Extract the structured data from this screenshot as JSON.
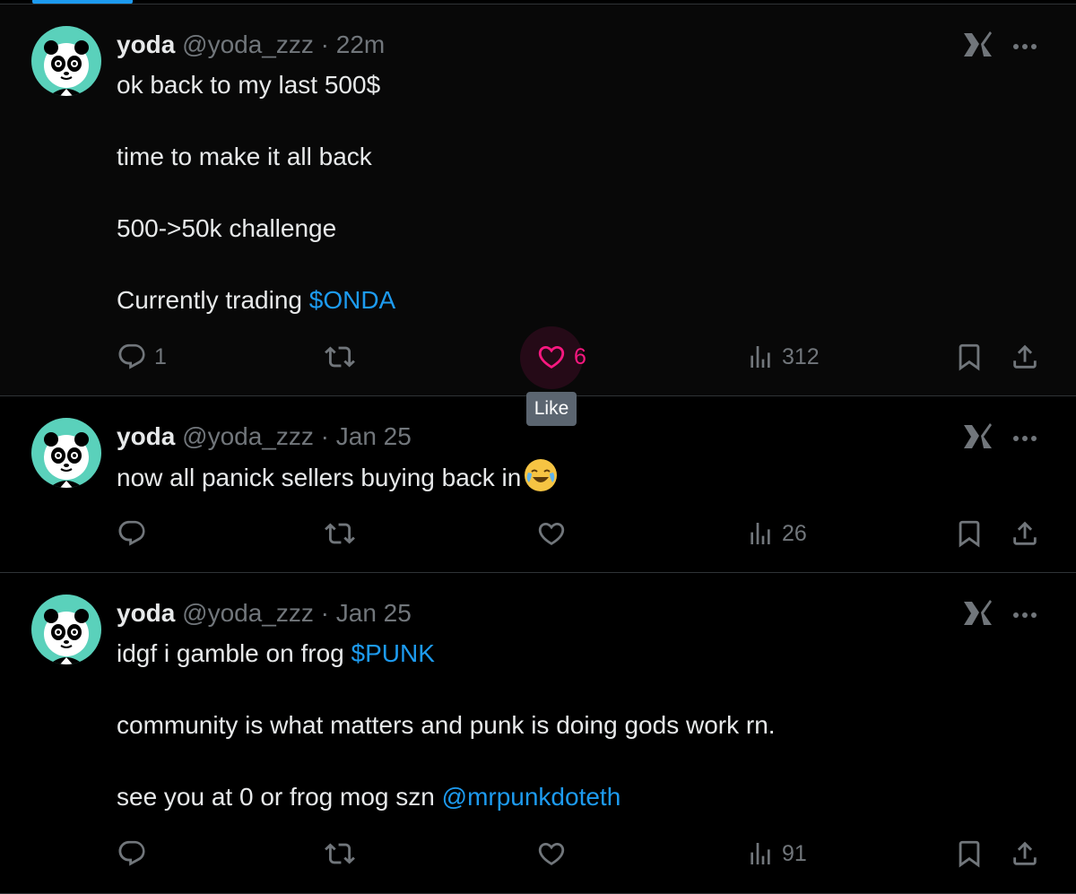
{
  "tweets": [
    {
      "name": "yoda",
      "handle": "@yoda_zzz",
      "sep": "·",
      "time": "22m",
      "lines": [
        {
          "text": "ok back to my last 500$"
        },
        {
          "text": ""
        },
        {
          "text": "time to make it all back"
        },
        {
          "text": ""
        },
        {
          "text": "500->50k challenge"
        },
        {
          "text": ""
        },
        {
          "text": "Currently trading ",
          "link": "$ONDA"
        }
      ],
      "stats": {
        "replies": "1",
        "reposts": "",
        "likes": "6",
        "views": "312"
      },
      "liked_hover": true
    },
    {
      "name": "yoda",
      "handle": "@yoda_zzz",
      "sep": "·",
      "time": "Jan 25",
      "lines": [
        {
          "text": "now all panick sellers buying back in",
          "emoji": "face-with-tears-of-joy"
        }
      ],
      "stats": {
        "replies": "",
        "reposts": "",
        "likes": "",
        "views": "26"
      }
    },
    {
      "name": "yoda",
      "handle": "@yoda_zzz",
      "sep": "·",
      "time": "Jan 25",
      "lines": [
        {
          "text": "idgf i gamble on frog ",
          "link": "$PUNK"
        },
        {
          "text": ""
        },
        {
          "text": "community is what matters and punk is doing gods work rn."
        },
        {
          "text": ""
        },
        {
          "text": "see you at 0 or frog mog szn ",
          "link": "@mrpunkdoteth"
        }
      ],
      "stats": {
        "replies": "",
        "reposts": "",
        "likes": "",
        "views": "91"
      }
    }
  ],
  "tooltip": {
    "label": "Like"
  },
  "colors": {
    "accent": "#1d9bf0",
    "like": "#f91880",
    "muted": "#71767b",
    "avatar_bg": "#5ad1bb"
  },
  "icons": [
    "reply-icon",
    "repost-icon",
    "like-icon",
    "views-icon",
    "bookmark-icon",
    "share-icon",
    "grok-icon",
    "more-icon"
  ]
}
